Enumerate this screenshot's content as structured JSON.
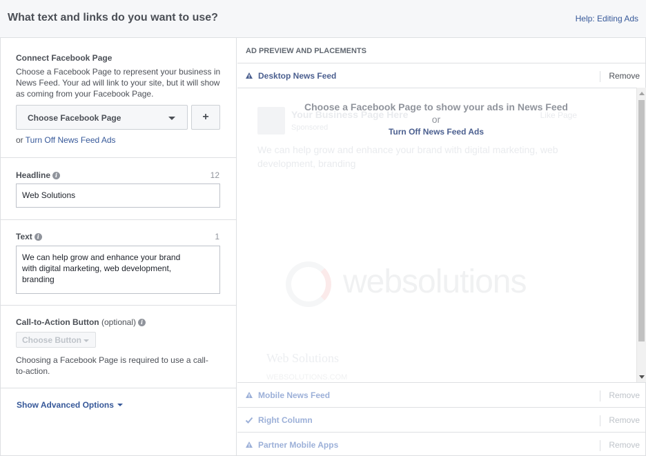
{
  "header": {
    "title": "What text and links do you want to use?",
    "help_link": "Help: Editing Ads"
  },
  "connect_page": {
    "label": "Connect Facebook Page",
    "description": "Choose a Facebook Page to represent your business in News Feed. Your ad will link to your site, but it will show as coming from your Facebook Page.",
    "dropdown_value": "Choose Facebook Page",
    "add_button": "+",
    "or_text": "or",
    "turn_off_link": "Turn Off News Feed Ads"
  },
  "headline": {
    "label": "Headline",
    "counter": "12",
    "value": "Web Solutions"
  },
  "text": {
    "label": "Text",
    "counter": "1",
    "value": "We can help grow and enhance your brand with digital marketing, web development, branding"
  },
  "cta": {
    "label": "Call-to-Action Button",
    "optional": "(optional)",
    "button": "Choose Button",
    "note": "Choosing a Facebook Page is required to use a call-to-action."
  },
  "advanced": {
    "label": "Show Advanced Options"
  },
  "preview": {
    "header": "AD PREVIEW AND PLACEMENTS",
    "message": "Choose a Facebook Page to show your ads in News Feed",
    "or_text": "or",
    "turn_off_link": "Turn Off News Feed Ads",
    "ghost": {
      "page_name": "Your Business Page Here",
      "sponsored": "Sponsored",
      "like_page": "Like Page",
      "body": "We can help grow and enhance your brand with digital marketing, web development, branding",
      "brand": "websolutions",
      "headline": "Web Solutions",
      "url": "WEBSOLUTIONS.COM"
    },
    "placements": [
      {
        "name": "Desktop News Feed",
        "remove": "Remove",
        "icon": "warning-icon"
      },
      {
        "name": "Mobile News Feed",
        "remove": "Remove",
        "icon": "warning-icon"
      },
      {
        "name": "Right Column",
        "remove": "Remove",
        "icon": "check-icon"
      },
      {
        "name": "Partner Mobile Apps",
        "remove": "Remove",
        "icon": "warning-icon"
      }
    ]
  },
  "colors": {
    "link": "#365899",
    "border": "#dddfe2",
    "header_bg": "#f6f7f9"
  }
}
